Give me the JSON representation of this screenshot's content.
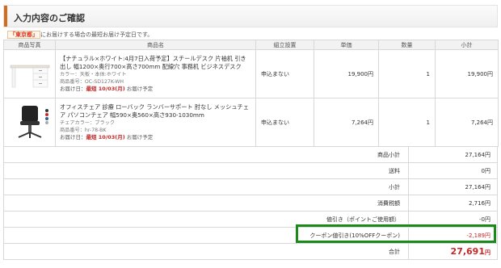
{
  "header": {
    "title": "入力内容のご確認"
  },
  "notice": {
    "tag": "「東京都」",
    "text": "にお届けする場合の最短お届け予定日です。"
  },
  "table": {
    "columns": [
      "商品写真",
      "商品名",
      "組立設置",
      "単価",
      "数量",
      "小計"
    ],
    "rows": [
      {
        "name": "【ナチュラル×ホワイト:4月7日入荷予定】スチールデスク 片袖机 引き出し 幅1200×奥行700×高さ700mm 配線穴 事務机 ビジネスデスク",
        "color": "カラー：天板・本体:ホワイト",
        "code": "商品番号：OC-SD127K-WH",
        "ship_label": "お届け日：",
        "ship_date": "最短 10/03(月)",
        "ship_suffix": " お届け予定",
        "assembly": "申込まない",
        "price": "19,900円",
        "qty": "1",
        "subtotal": "19,900円"
      },
      {
        "name": "オフィスチェア 診療 ローバック ランバーサポート 肘なし メッシュチェア パソコンチェア 幅590×奥560×高さ930-1030mm",
        "color": "チェアカラー：ブラック",
        "code": "商品番号：hr-78-BK",
        "ship_label": "お届け日：",
        "ship_date": "最短 10/03(月)",
        "ship_suffix": " お届け予定",
        "assembly": "申込まない",
        "price": "7,264円",
        "qty": "1",
        "subtotal": "7,264円"
      }
    ]
  },
  "summary": {
    "goods_subtotal": {
      "label": "商品小計",
      "value": "27,164円"
    },
    "shipping": {
      "label": "送料",
      "value": "0円"
    },
    "subtotal": {
      "label": "小計",
      "value": "27,164円"
    },
    "tax": {
      "label": "消費税額",
      "value": "2,716円"
    },
    "point_discount": {
      "label": "値引き（ポイントご使用額）",
      "value": "-0円"
    },
    "coupon_discount": {
      "label": "クーポン値引き(10%OFFクーポン)",
      "value": "-2,189円"
    },
    "total": {
      "label": "合計",
      "value": "27,691",
      "unit": "円"
    }
  },
  "colors": {
    "accent": "#d46b1f",
    "price_red": "#c62828",
    "highlight_green": "#1b8a1b"
  },
  "icons": {
    "desk": "desk-thumbnail",
    "chair": "chair-thumbnail"
  }
}
